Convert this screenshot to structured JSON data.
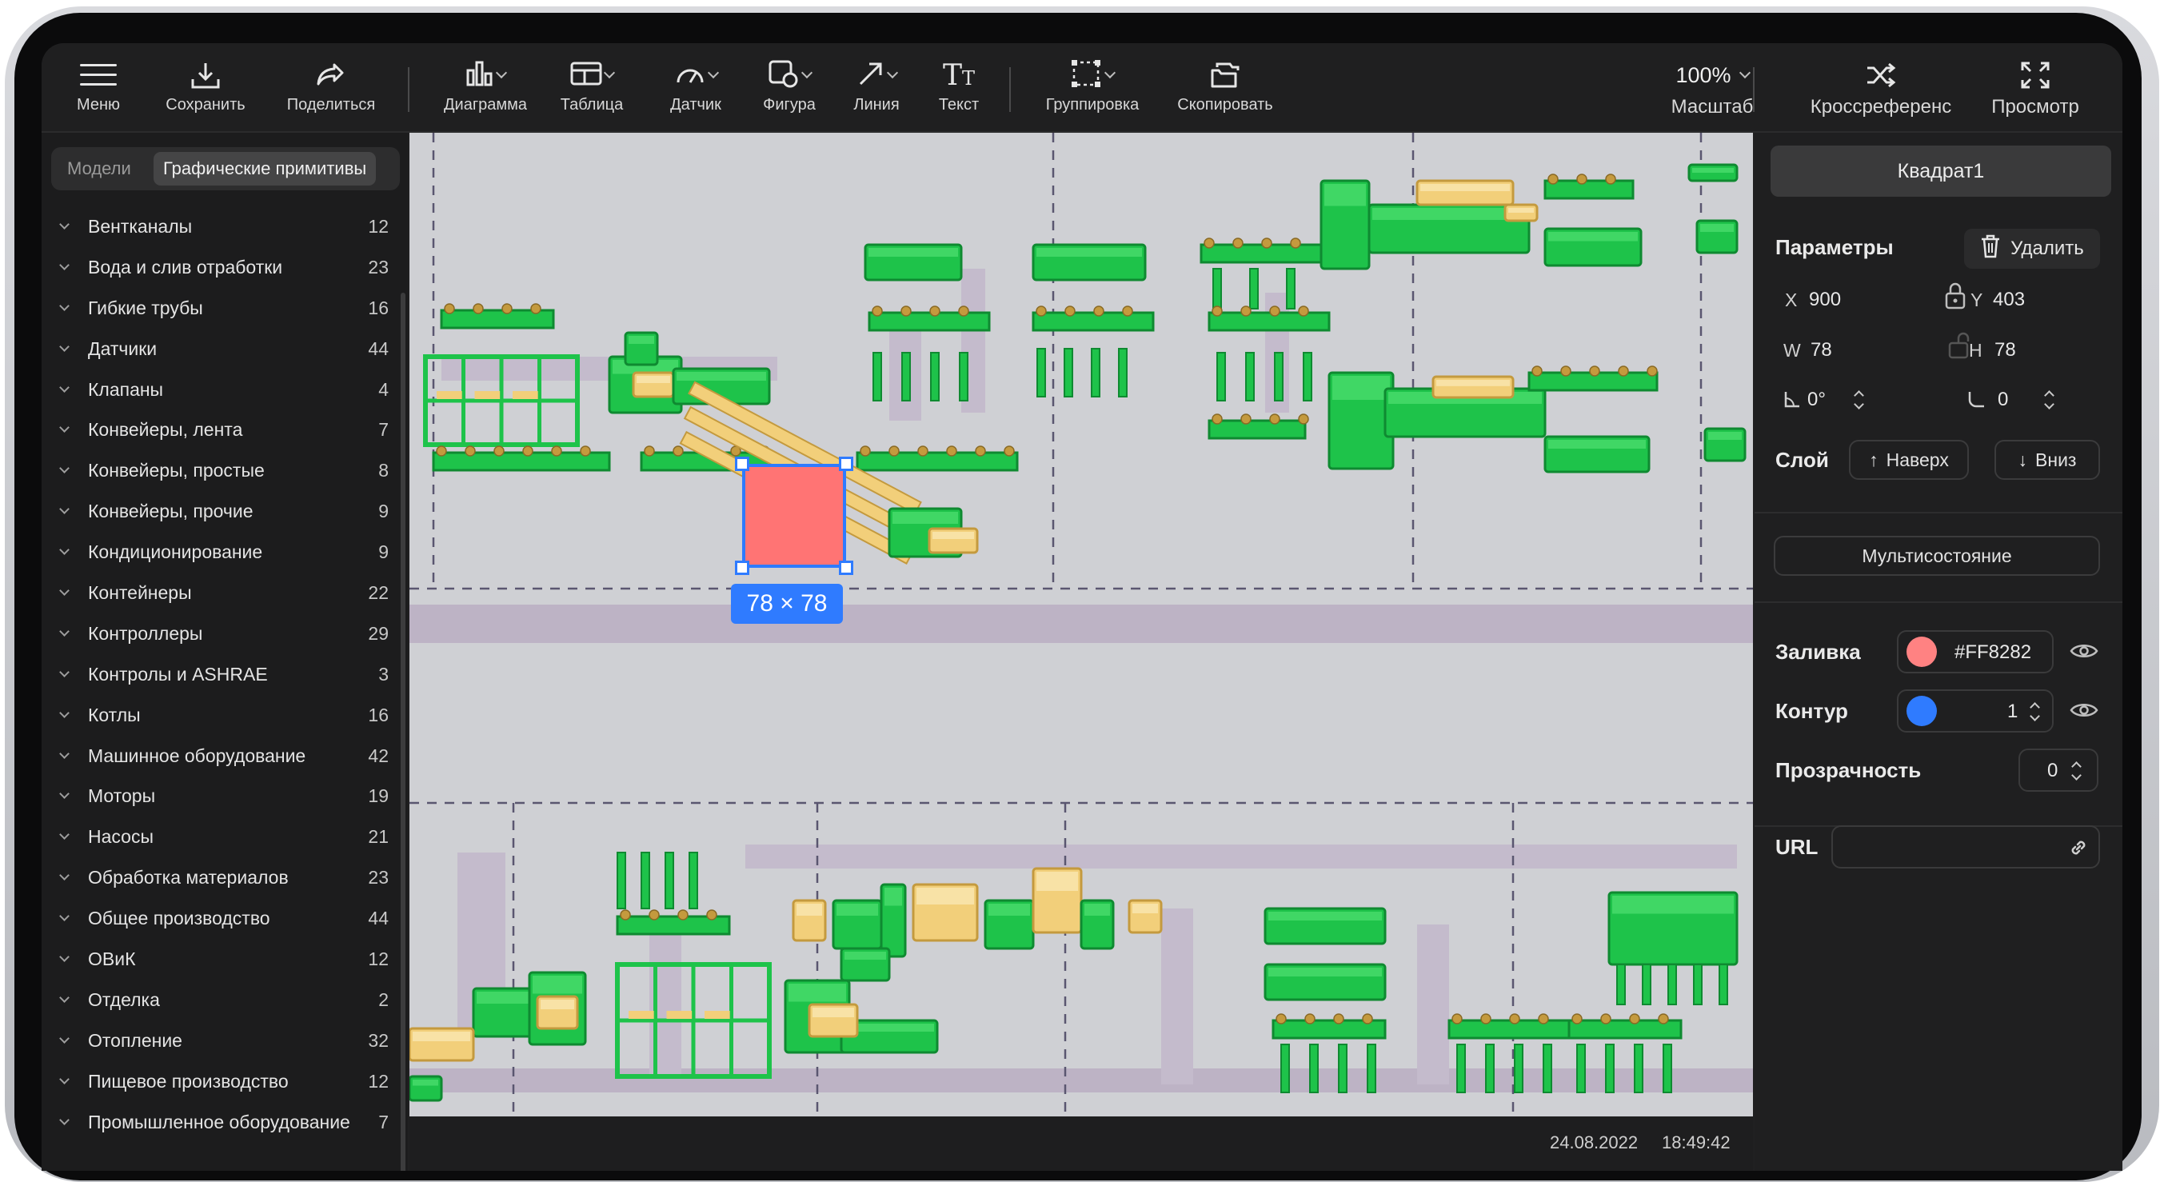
{
  "toolbar": {
    "menu": "Меню",
    "save": "Сохранить",
    "share": "Поделиться",
    "chart": "Диаграмма",
    "table": "Таблица",
    "gauge": "Датчик",
    "shape": "Фигура",
    "line": "Линия",
    "text": "Текст",
    "group": "Группировка",
    "copy": "Скопировать",
    "zoom_value": "100%",
    "zoom_label": "Масштаб",
    "crossref": "Кроссреференс",
    "preview": "Просмотр"
  },
  "left_panel": {
    "tabs": [
      "Модели",
      "Графические примитивы"
    ],
    "active_tab": "Графические примитивы",
    "items": [
      {
        "name": "Вентканалы",
        "count": "12"
      },
      {
        "name": "Вода и слив отработки",
        "count": "23"
      },
      {
        "name": "Гибкие трубы",
        "count": "16"
      },
      {
        "name": "Датчики",
        "count": "44"
      },
      {
        "name": "Клапаны",
        "count": "4"
      },
      {
        "name": "Конвейеры, лента",
        "count": "7"
      },
      {
        "name": "Конвейеры, простые",
        "count": "8"
      },
      {
        "name": "Конвейеры, прочие",
        "count": "9"
      },
      {
        "name": "Кондиционирование",
        "count": "9"
      },
      {
        "name": "Контейнеры",
        "count": "22"
      },
      {
        "name": "Контроллеры",
        "count": "29"
      },
      {
        "name": "Контролы и ASHRAE",
        "count": "3"
      },
      {
        "name": "Котлы",
        "count": "16"
      },
      {
        "name": "Машинное оборудование",
        "count": "42"
      },
      {
        "name": "Моторы",
        "count": "19"
      },
      {
        "name": "Насосы",
        "count": "21"
      },
      {
        "name": "Обработка материалов",
        "count": "23"
      },
      {
        "name": "Общее производство",
        "count": "44"
      },
      {
        "name": "ОВиК",
        "count": "12"
      },
      {
        "name": "Отделка",
        "count": "2"
      },
      {
        "name": "Отопление",
        "count": "32"
      },
      {
        "name": "Пищевое производство",
        "count": "12"
      },
      {
        "name": "Промышленное оборудование",
        "count": "7"
      }
    ]
  },
  "canvas": {
    "selection_size": "78 × 78",
    "selection_fill": "#FF7474",
    "selection_stroke": "#2f7bff"
  },
  "status": {
    "date": "24.08.2022",
    "time": "18:49:42"
  },
  "right_panel": {
    "object_name": "Квадрат1",
    "params_title": "Параметры",
    "delete": "Удалить",
    "x_label": "X",
    "x_value": "900",
    "y_label": "Y",
    "y_value": "403",
    "w_label": "W",
    "w_value": "78",
    "h_label": "H",
    "h_value": "78",
    "angle_value": "0°",
    "corner_value": "0",
    "layer_title": "Слой",
    "layer_up": "Наверх",
    "layer_down": "Вниз",
    "multistate": "Мультисостояние",
    "fill_title": "Заливка",
    "fill_color": "#FF8282",
    "fill_value": "#FF8282",
    "stroke_title": "Контур",
    "stroke_color": "#2f7bff",
    "stroke_value": "1",
    "opacity_title": "Прозрачность",
    "opacity_value": "0",
    "url_title": "URL",
    "url_value": ""
  }
}
